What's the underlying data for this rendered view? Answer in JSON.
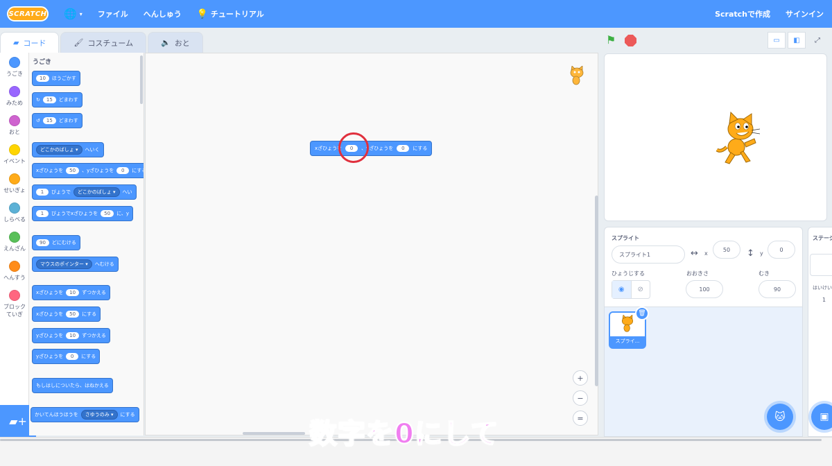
{
  "menubar": {
    "logo": "SCRATCH",
    "file": "ファイル",
    "edit": "へんしゅう",
    "tutorial": "チュートリアル",
    "create": "Scratchで作成",
    "signin": "サインイン"
  },
  "tabs": {
    "code": "コード",
    "costumes": "コスチューム",
    "sounds": "おと"
  },
  "categories": [
    "うごき",
    "みため",
    "おと",
    "イベント",
    "せいぎょ",
    "しらべる",
    "えんざん",
    "へんすう",
    "ブロック",
    "ていぎ"
  ],
  "category_colors": {
    "motion": "#4c97ff",
    "looks": "#9966ff",
    "sound": "#cf63cf",
    "events": "#ffd500",
    "control": "#ffab19",
    "sensing": "#5cb1d6",
    "operators": "#59c059",
    "variables": "#ff8c1a",
    "myblocks": "#ff6680"
  },
  "palette": {
    "title": "うごき",
    "move": {
      "num": "10",
      "text": "ほうごかす"
    },
    "turn_right": {
      "num": "15",
      "text": "どまわす"
    },
    "turn_left": {
      "num": "15",
      "text": "どまわす"
    },
    "goto": {
      "drop": "どこかのばしょ ▾",
      "text": "へいく"
    },
    "goto_xy": {
      "a": "xざひょうを",
      "x": "50",
      "b": "、yざひょうを",
      "y": "0",
      "c": "にする"
    },
    "glide": {
      "num": "1",
      "a": "びょうで",
      "drop": "どこかのばしょ ▾",
      "b": "へい"
    },
    "glide_xy": {
      "num": "1",
      "a": "びょうでxざひょうを",
      "x": "50",
      "b": "に、y"
    },
    "point_dir": {
      "num": "90",
      "text": "どにむける"
    },
    "point_towards": {
      "drop": "マウスのポインター ▾",
      "text": "へむける"
    },
    "change_x": {
      "a": "xざひょうを",
      "num": "10",
      "b": "ずつかえる"
    },
    "set_x": {
      "a": "xざひょうを",
      "num": "50",
      "b": "にする"
    },
    "change_y": {
      "a": "yざひょうを",
      "num": "10",
      "b": "ずつかえる"
    },
    "set_y": {
      "a": "yざひょうを",
      "num": "0",
      "b": "にする"
    },
    "bounce": "もしはしについたら、はねかえる",
    "rotation": {
      "a": "かいてんほうほうを",
      "drop": "さゆうのみ ▾",
      "b": "にする"
    }
  },
  "code_block": {
    "a": "xざひょうを",
    "x": "0",
    "b": "、yざひょうを",
    "y": "0",
    "c": "にする"
  },
  "zoom": {
    "in": "+",
    "out": "−",
    "reset": "="
  },
  "sprite_info": {
    "label_sprite": "スプライト",
    "name": "スプライト1",
    "label_x": "x",
    "x": "50",
    "label_y": "y",
    "y": "0",
    "label_show": "ひょうじする",
    "label_size": "おおきさ",
    "size": "100",
    "label_direction": "むき",
    "direction": "90"
  },
  "sprite_list": {
    "thumb_label": "スプライ..."
  },
  "stage_pane": {
    "title": "ステージ",
    "backdrops_label": "はいけい",
    "backdrops_count": "1"
  },
  "caption": "数字を0にして"
}
